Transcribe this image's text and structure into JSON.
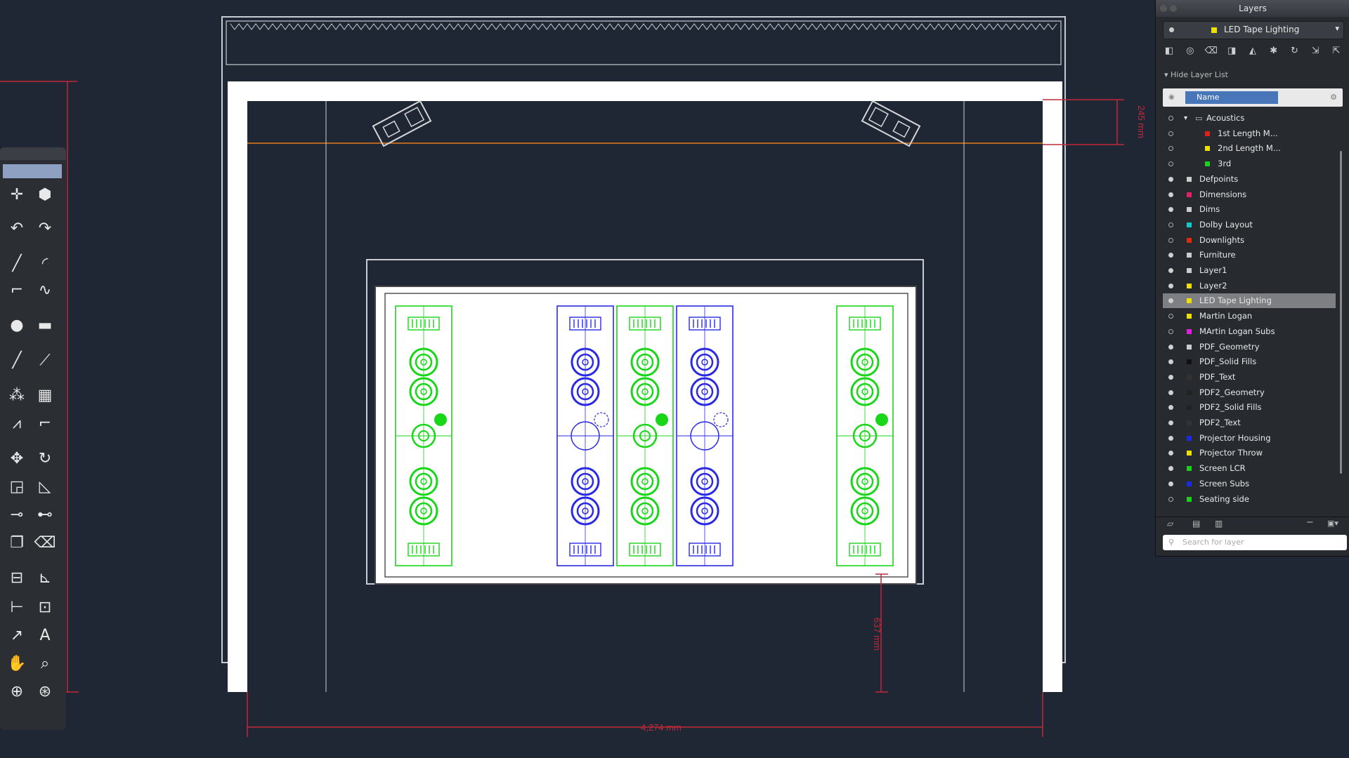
{
  "panel": {
    "title": "Layers",
    "current_layer": "LED Tape Lighting",
    "hide_layer_list": "Hide Layer List",
    "column_name": "Name",
    "search_placeholder": "Search for layer",
    "layers": [
      {
        "name": "Acoustics",
        "indent": 2,
        "visible": false,
        "color": "#9a9a9a",
        "group": true
      },
      {
        "name": "1st Length M...",
        "indent": 3,
        "visible": false,
        "color": "#e02020"
      },
      {
        "name": "2nd Length M...",
        "indent": 3,
        "visible": false,
        "color": "#f0e000"
      },
      {
        "name": "3rd",
        "indent": 3,
        "visible": false,
        "color": "#1ad01a"
      },
      {
        "name": "Defpoints",
        "indent": 1,
        "visible": true,
        "color": "#cccccc"
      },
      {
        "name": "Dimensions",
        "indent": 1,
        "visible": true,
        "color": "#e0206a"
      },
      {
        "name": "Dims",
        "indent": 1,
        "visible": true,
        "color": "#cccccc"
      },
      {
        "name": "Dolby Layout",
        "indent": 1,
        "visible": false,
        "color": "#10c8d0"
      },
      {
        "name": "Downlights",
        "indent": 1,
        "visible": false,
        "color": "#e02a10"
      },
      {
        "name": "Furniture",
        "indent": 1,
        "visible": true,
        "color": "#cccccc"
      },
      {
        "name": "Layer1",
        "indent": 1,
        "visible": true,
        "color": "#cccccc"
      },
      {
        "name": "Layer2",
        "indent": 1,
        "visible": true,
        "color": "#f0e000"
      },
      {
        "name": "LED Tape Lighting",
        "indent": 1,
        "visible": true,
        "color": "#f0e000",
        "selected": true
      },
      {
        "name": "Martin Logan",
        "indent": 1,
        "visible": false,
        "color": "#f0e000"
      },
      {
        "name": "MArtin Logan Subs",
        "indent": 1,
        "visible": false,
        "color": "#e020e0"
      },
      {
        "name": "PDF_Geometry",
        "indent": 1,
        "visible": true,
        "color": "#cccccc"
      },
      {
        "name": "PDF_Solid Fills",
        "indent": 1,
        "visible": true,
        "color": "#111111"
      },
      {
        "name": "PDF_Text",
        "indent": 1,
        "visible": true,
        "color": "#333333"
      },
      {
        "name": "PDF2_Geometry",
        "indent": 1,
        "visible": true,
        "color": "#222222"
      },
      {
        "name": "PDF2_Solid Fills",
        "indent": 1,
        "visible": true,
        "color": "#222222"
      },
      {
        "name": "PDF2_Text",
        "indent": 1,
        "visible": true,
        "color": "#333333"
      },
      {
        "name": "Projector Housing",
        "indent": 1,
        "visible": true,
        "color": "#1a2ae0"
      },
      {
        "name": "Projector Throw",
        "indent": 1,
        "visible": true,
        "color": "#f0e000"
      },
      {
        "name": "Screen LCR",
        "indent": 1,
        "visible": true,
        "color": "#1ad01a"
      },
      {
        "name": "Screen Subs",
        "indent": 1,
        "visible": true,
        "color": "#1a2ae0"
      },
      {
        "name": "Seating side",
        "indent": 1,
        "visible": false,
        "color": "#1ad01a"
      }
    ]
  },
  "drawing": {
    "dim_width": "4,274 mm",
    "dim_top": "245 mm",
    "dim_bottom": "637 mm",
    "colors": {
      "background": "#1f2734",
      "dimension": "#c0283a",
      "speaker_green": "#19d619",
      "speaker_blue": "#2a2ae6",
      "wall": "#ffffff"
    }
  },
  "tools": {
    "icons": [
      "crosshair-icon",
      "cube-icon",
      "undo-icon",
      "redo-icon",
      "line-icon",
      "arc-icon",
      "polyline-icon",
      "spline-icon",
      "circle-icon",
      "rectangle-icon",
      "construction-line-icon",
      "ray-icon",
      "array-icon",
      "grid-array-icon",
      "mirror-icon",
      "offset-icon",
      "move-icon",
      "rotate-icon",
      "scale-icon",
      "stretch-icon",
      "trim-icon",
      "extend-icon",
      "copy-icon",
      "erase-icon",
      "linear-dimension-icon",
      "angular-dimension-icon",
      "baseline-dimension-icon",
      "block-icon",
      "leader-icon",
      "text-icon",
      "pan-icon",
      "zoom-icon",
      "zoom-in-icon",
      "zoom-extents-icon"
    ]
  }
}
